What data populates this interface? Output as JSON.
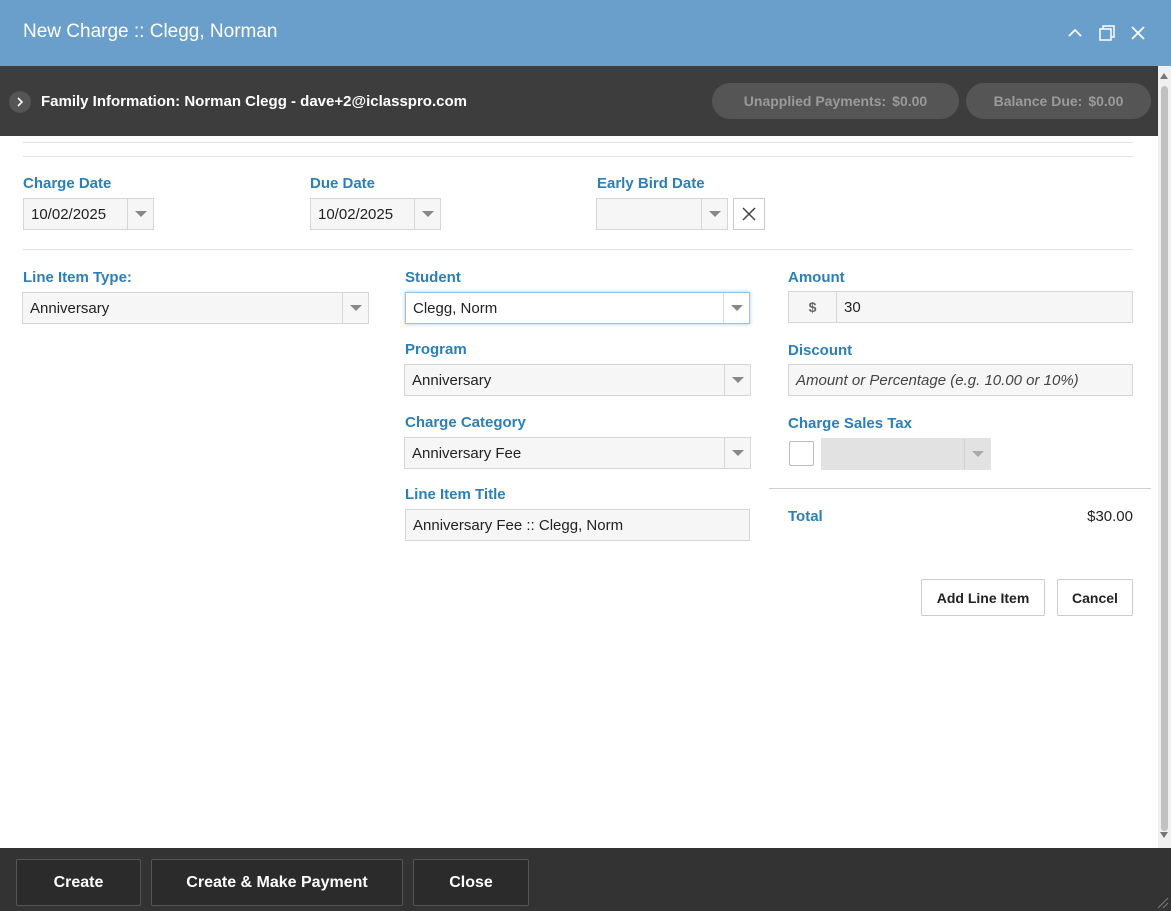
{
  "window": {
    "title": "New Charge :: Clegg, Norman"
  },
  "family_bar": {
    "label": "Family Information: Norman Clegg - dave+2@iclasspro.com",
    "unapplied_label": "Unapplied Payments:",
    "unapplied_value": "$0.00",
    "balance_label": "Balance Due:",
    "balance_value": "$0.00"
  },
  "dates": {
    "charge_date_label": "Charge Date",
    "charge_date_value": "10/02/2025",
    "due_date_label": "Due Date",
    "due_date_value": "10/02/2025",
    "early_bird_label": "Early Bird Date",
    "early_bird_value": ""
  },
  "line_item": {
    "type_label": "Line Item Type:",
    "type_value": "Anniversary",
    "student_label": "Student",
    "student_value": "Clegg, Norm",
    "program_label": "Program",
    "program_value": "Anniversary",
    "category_label": "Charge Category",
    "category_value": "Anniversary Fee",
    "title_label": "Line Item Title",
    "title_value": "Anniversary Fee :: Clegg, Norm"
  },
  "amounts": {
    "amount_label": "Amount",
    "currency_symbol": "$",
    "amount_value": "30",
    "discount_label": "Discount",
    "discount_placeholder": "Amount or Percentage (e.g. 10.00 or 10%)",
    "sales_tax_label": "Charge Sales Tax",
    "sales_tax_checked": false,
    "total_label": "Total",
    "total_value": "$30.00"
  },
  "actions": {
    "add_line_item": "Add Line Item",
    "cancel": "Cancel"
  },
  "footer": {
    "create": "Create",
    "create_and_pay": "Create & Make Payment",
    "close": "Close"
  },
  "colors": {
    "title_bar": "#6a9fcb",
    "family_bar": "#3d3d3d",
    "label_blue": "#2c7fb8",
    "footer": "#333333"
  }
}
